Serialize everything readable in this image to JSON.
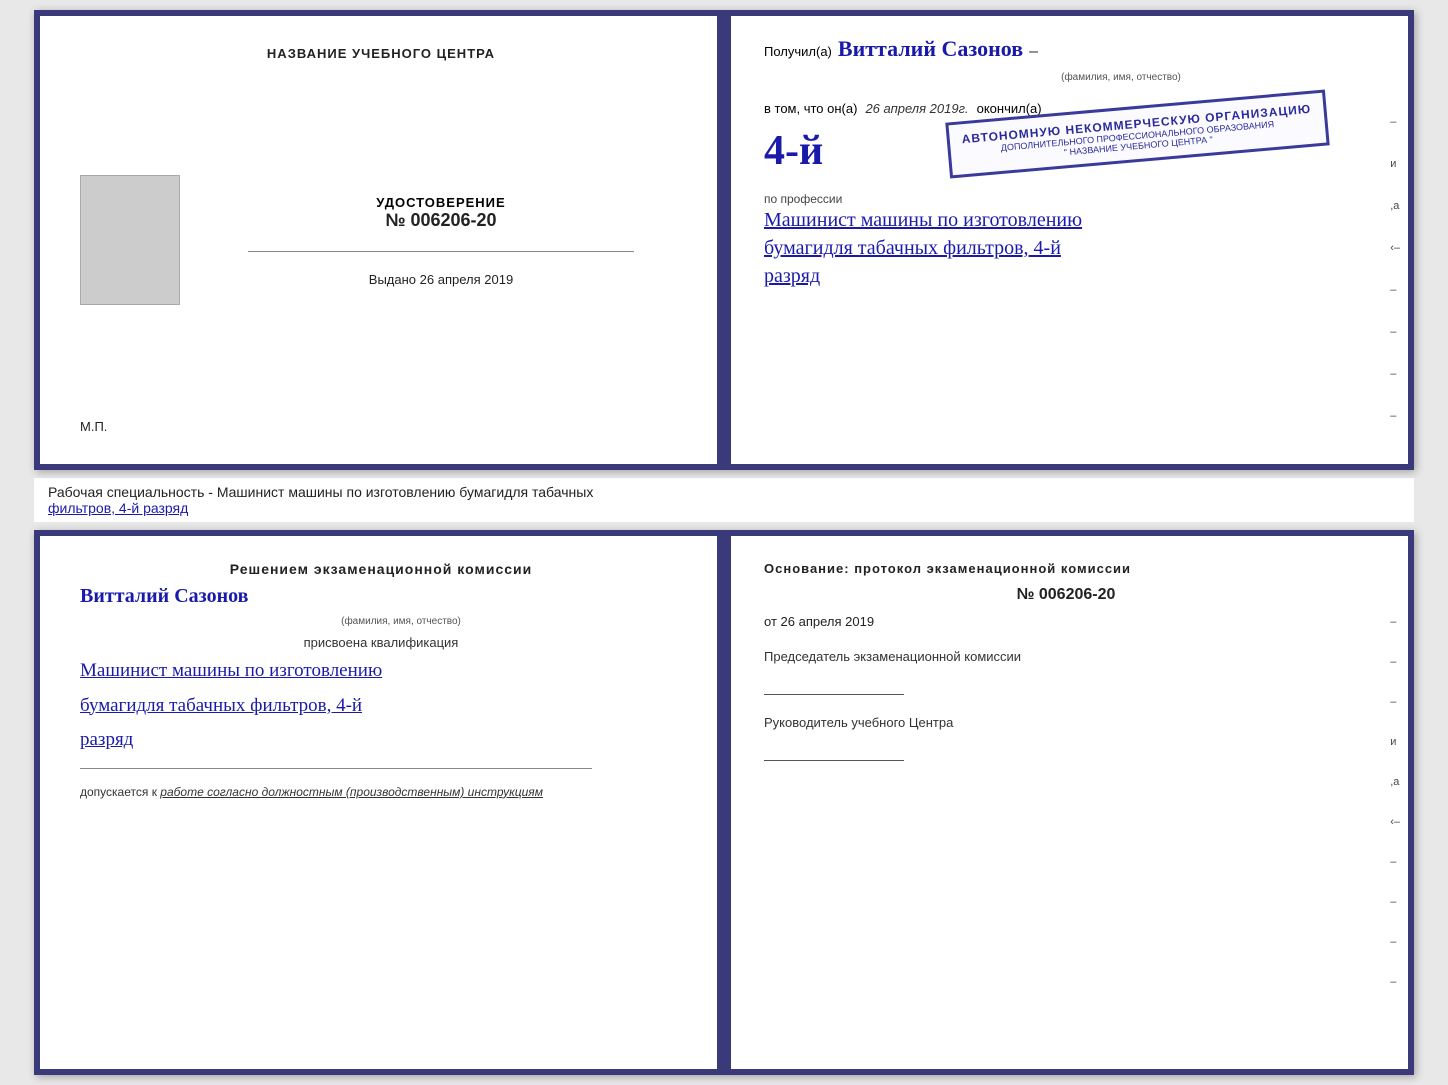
{
  "page": {
    "bg_color": "#e8e8e8"
  },
  "cert_top": {
    "left": {
      "title": "НАЗВАНИЕ УЧЕБНОГО ЦЕНТРА",
      "udostoverenie_label": "УДОСТОВЕРЕНИЕ",
      "number": "№ 006206-20",
      "vydano_label": "Выдано",
      "vydano_date": "26 апреля 2019",
      "mp": "М.П."
    },
    "right": {
      "poluchil_prefix": "Получил(а)",
      "recipient_name": "Витталий  Сазонов",
      "fio_label": "(фамилия, имя, отчество)",
      "vtom_prefix": "в том, что он(а)",
      "vtom_date": "26 апреля 2019г.",
      "okonchil": "окончил(а)",
      "big_4": "4-й",
      "stamp_line1": "АВТОНОМНУЮ НЕКОММЕРЧЕСКУЮ ОРГАНИЗАЦИЮ",
      "stamp_line2": "ДОПОЛНИТЕЛЬНОГО ПРОФЕССИОНАЛЬНОГО ОБРАЗОВАНИЯ",
      "stamp_line3": "\" НАЗВАНИЕ УЧЕБНОГО ЦЕНТРА \"",
      "po_professii": "по профессии",
      "profession1": "Машинист машины по изготовлению",
      "profession2": "бумагидля табачных фильтров, 4-й",
      "profession3": "разряд",
      "side_marks": [
        "–",
        "и",
        ",а",
        "‹–",
        "–",
        "–",
        "–",
        "–"
      ]
    }
  },
  "middle_label": {
    "text_normal": "Рабочая специальность - Машинист машины по изготовлению бумагидля табачных",
    "text_underline": "фильтров, 4-й разряд"
  },
  "cert_bottom": {
    "left": {
      "decision_title": "Решением  экзаменационной  комиссии",
      "name": "Витталий  Сазонов",
      "fio_label": "(фамилия, имя, отчество)",
      "prisvoena": "присвоена квалификация",
      "qual1": "Машинист машины по изготовлению",
      "qual2": "бумагидля табачных фильтров, 4-й",
      "qual3": "разряд",
      "dopusk_prefix": "допускается к",
      "dopusk_text": "работе согласно должностным (производственным) инструкциям"
    },
    "right": {
      "osnov_label": "Основание: протокол экзаменационной  комиссии",
      "protocol_number": "№  006206-20",
      "ot_label": "от",
      "ot_date": "26 апреля 2019",
      "predsed_label": "Председатель экзаменационной комиссии",
      "rukov_label": "Руководитель учебного Центра",
      "side_marks": [
        "–",
        "–",
        "–",
        "и",
        ",а",
        "‹–",
        "–",
        "–",
        "–",
        "–"
      ]
    }
  }
}
